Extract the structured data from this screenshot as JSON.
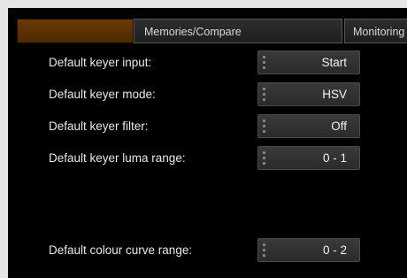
{
  "tabs": [
    {
      "label": ""
    },
    {
      "label": "Memories/Compare"
    },
    {
      "label": "Monitoring"
    }
  ],
  "settings": [
    {
      "label": "Default keyer input:",
      "value": "Start"
    },
    {
      "label": "Default keyer mode:",
      "value": "HSV"
    },
    {
      "label": "Default keyer filter:",
      "value": "Off"
    },
    {
      "label": "Default keyer luma range:",
      "value": "0 - 1"
    },
    {
      "label": "Default colour curve range:",
      "value": "0 - 2"
    }
  ],
  "colors": {
    "active_tab": "#5a3104",
    "panel_background": "#000000",
    "page_background": "#e6e6e6"
  }
}
